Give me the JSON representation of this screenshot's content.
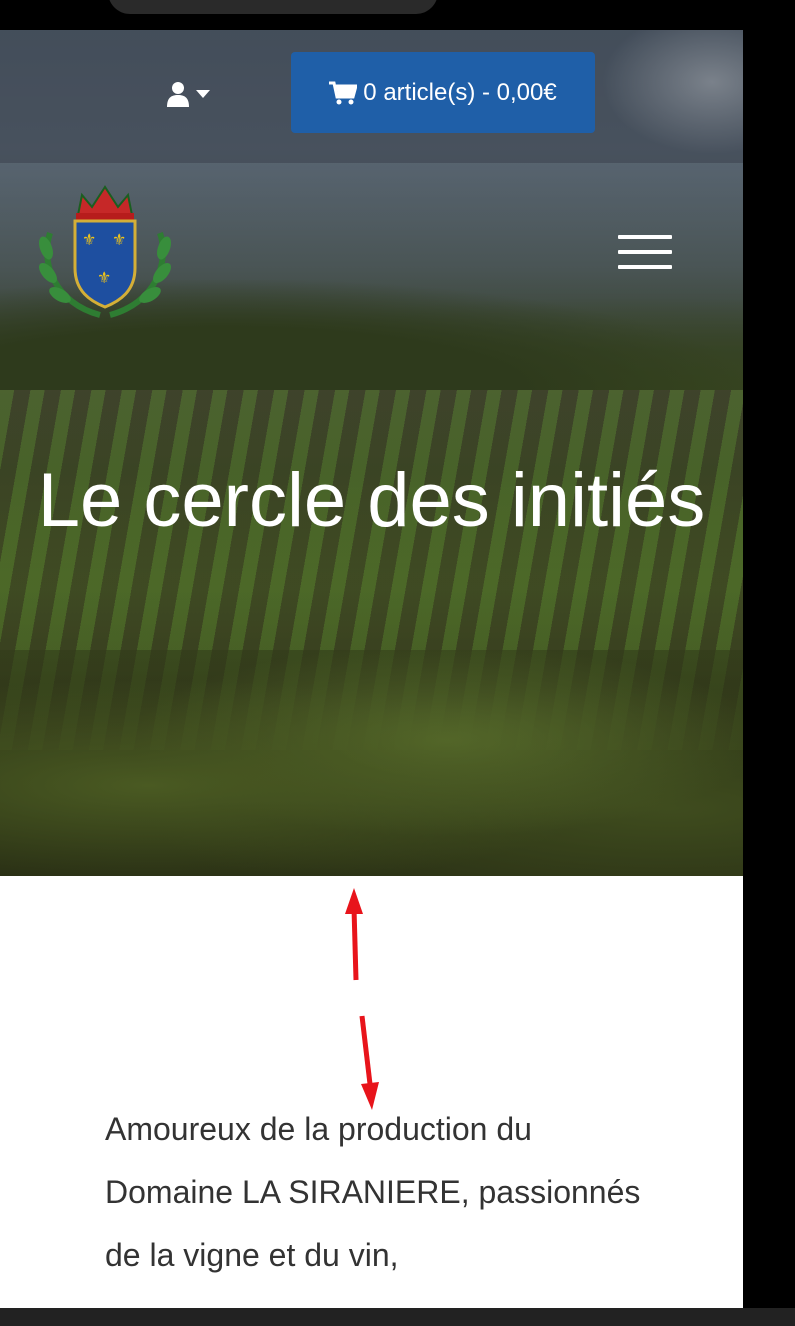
{
  "header": {
    "cart_label": "0 article(s) - 0,00€",
    "cart_icon": "shopping-cart-icon",
    "user_icon": "user-icon",
    "user_caret_icon": "caret-down-icon",
    "menu_icon": "hamburger-menu-icon",
    "cart_color": "#1f5fa8"
  },
  "hero": {
    "title": "Le cercle des initiés"
  },
  "content": {
    "intro_text": "Amoureux de la production du Domaine LA SIRANIERE, passionnés de la vigne et du vin,"
  },
  "annotation": {
    "arrow_color": "#e8141b"
  }
}
